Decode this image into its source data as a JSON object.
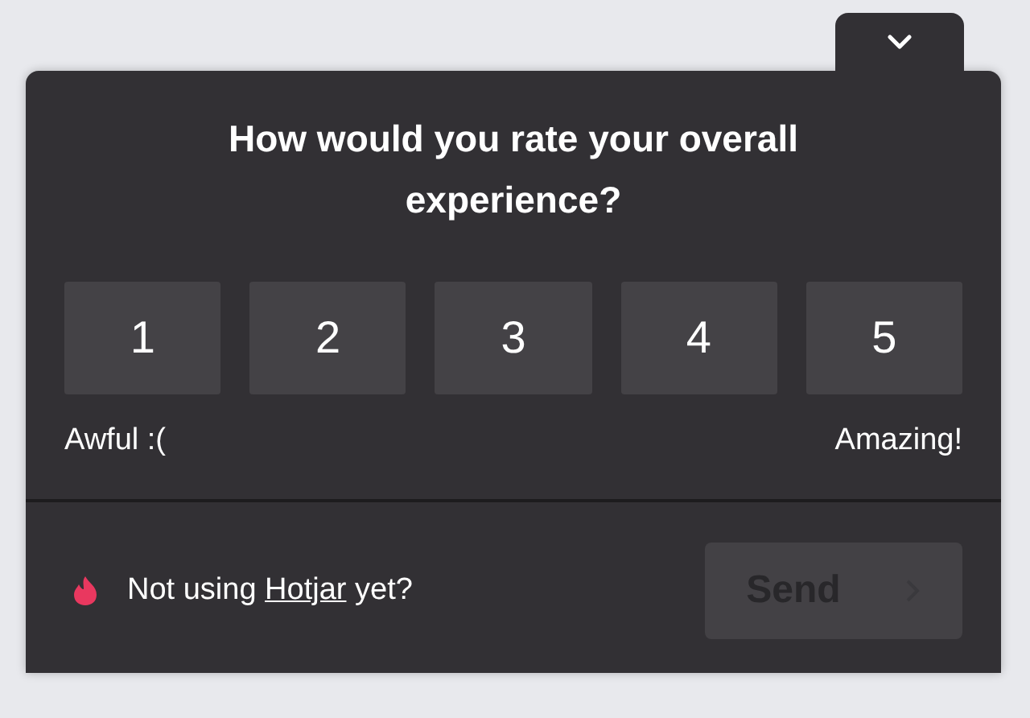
{
  "question": "How would you rate your overall experience?",
  "ratings": [
    {
      "label": "1",
      "selected": false
    },
    {
      "label": "2",
      "selected": false
    },
    {
      "label": "3",
      "selected": false
    },
    {
      "label": "4",
      "selected": false
    },
    {
      "label": "5",
      "selected": false
    }
  ],
  "scale_labels": {
    "low": "Awful :(",
    "high": "Amazing!"
  },
  "footer": {
    "prefix": "Not using",
    "link": "Hotjar",
    "suffix": "yet?"
  },
  "send_button": {
    "label": "Send",
    "disabled": true
  }
}
